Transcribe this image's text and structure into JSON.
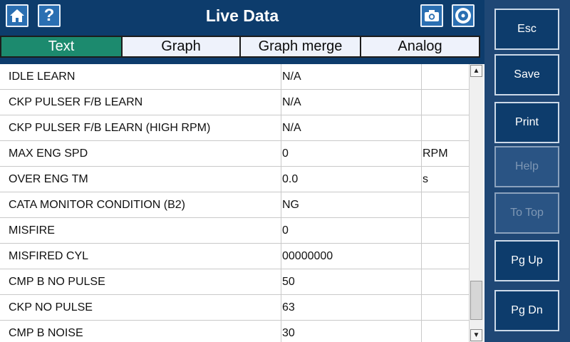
{
  "header": {
    "title": "Live Data",
    "icons": [
      "home-icon",
      "help-icon",
      "camera-icon",
      "disc-icon"
    ],
    "help_glyph": "?"
  },
  "tabs": [
    {
      "label": "Text",
      "active": true
    },
    {
      "label": "Graph",
      "active": false
    },
    {
      "label": "Graph merge",
      "active": false
    },
    {
      "label": "Analog",
      "active": false
    }
  ],
  "rows": [
    {
      "name": "IDLE LEARN",
      "value": "N/A",
      "unit": ""
    },
    {
      "name": "CKP PULSER F/B LEARN",
      "value": "N/A",
      "unit": ""
    },
    {
      "name": "CKP PULSER F/B LEARN (HIGH RPM)",
      "value": "N/A",
      "unit": ""
    },
    {
      "name": "MAX ENG SPD",
      "value": "0",
      "unit": "RPM"
    },
    {
      "name": "OVER ENG TM",
      "value": "0.0",
      "unit": "s"
    },
    {
      "name": "CATA MONITOR CONDITION (B2)",
      "value": "NG",
      "unit": ""
    },
    {
      "name": "MISFIRE",
      "value": "0",
      "unit": ""
    },
    {
      "name": "MISFIRED CYL",
      "value": "00000000",
      "unit": ""
    },
    {
      "name": "CMP B NO PULSE",
      "value": "50",
      "unit": ""
    },
    {
      "name": "CKP NO PULSE",
      "value": "63",
      "unit": ""
    },
    {
      "name": "CMP B NOISE",
      "value": "30",
      "unit": ""
    }
  ],
  "side_buttons": [
    {
      "label": "Esc",
      "enabled": true
    },
    {
      "label": "Save",
      "enabled": true
    },
    {
      "label": "Print",
      "enabled": true
    },
    {
      "label": "Help",
      "enabled": false
    },
    {
      "label": "To Top",
      "enabled": false
    },
    {
      "label": "Pg Up",
      "enabled": true
    },
    {
      "label": "Pg Dn",
      "enabled": true
    }
  ],
  "colors": {
    "header_bg": "#0d3c6c",
    "active_tab": "#1c8a6e",
    "side_bg": "#1f4775"
  }
}
